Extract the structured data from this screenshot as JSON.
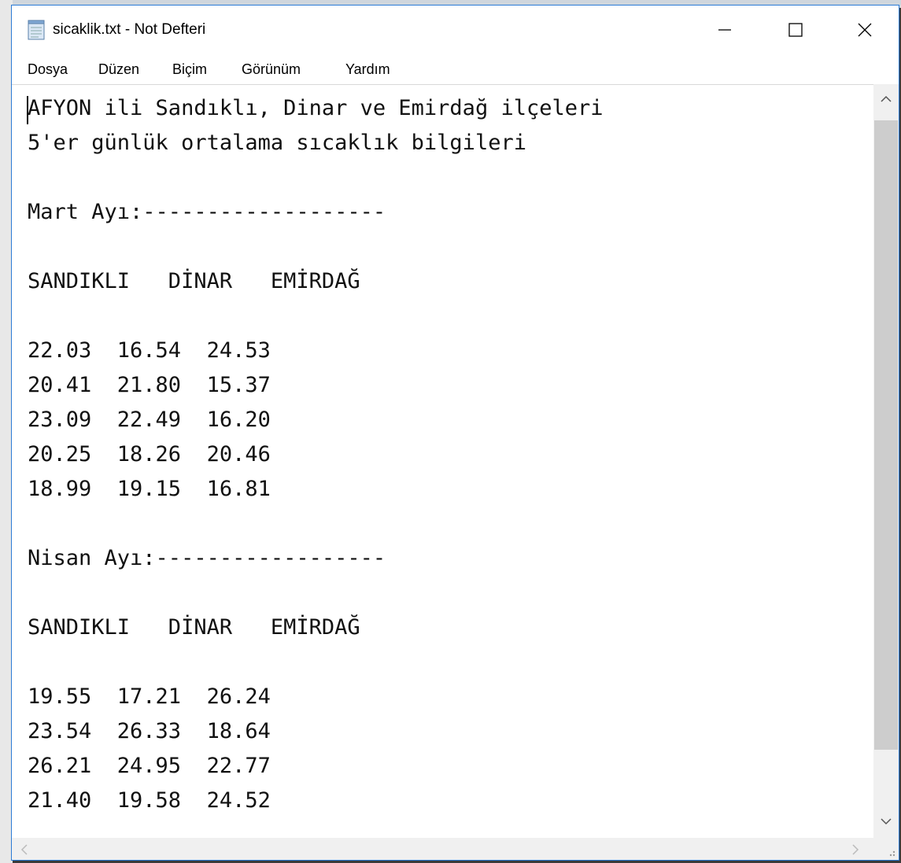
{
  "window": {
    "title": "sicaklik.txt - Not Defteri"
  },
  "menu": {
    "items": [
      "Dosya",
      "Düzen",
      "Biçim",
      "Görünüm",
      "Yardım"
    ]
  },
  "editor": {
    "content": "AFYON ili Sandıklı, Dinar ve Emirdağ ilçeleri\n5'er günlük ortalama sıcaklık bilgileri\n\nMart Ayı:-------------------\n\nSANDIKLI   DİNAR   EMİRDAĞ\n\n22.03  16.54  24.53\n20.41  21.80  15.37\n23.09  22.49  16.20\n20.25  18.26  20.46\n18.99  19.15  16.81\n\nNisan Ayı:------------------\n\nSANDIKLI   DİNAR   EMİRDAĞ\n\n19.55  17.21  26.24\n23.54  26.33  18.64\n26.21  24.95  22.77\n21.40  19.58  24.52"
  },
  "icons": {
    "app": "notepad-icon",
    "minimize": "minimize-icon",
    "maximize": "maximize-icon",
    "close": "close-icon",
    "scroll_up": "chevron-up-icon",
    "scroll_down": "chevron-down-icon",
    "scroll_left": "chevron-left-icon",
    "scroll_right": "chevron-right-icon",
    "resize": "resize-grip-icon"
  },
  "colors": {
    "window_border": "#2b7bd6",
    "scrollbar_track": "#f0f0f0",
    "scrollbar_thumb": "#cdcdcd"
  }
}
